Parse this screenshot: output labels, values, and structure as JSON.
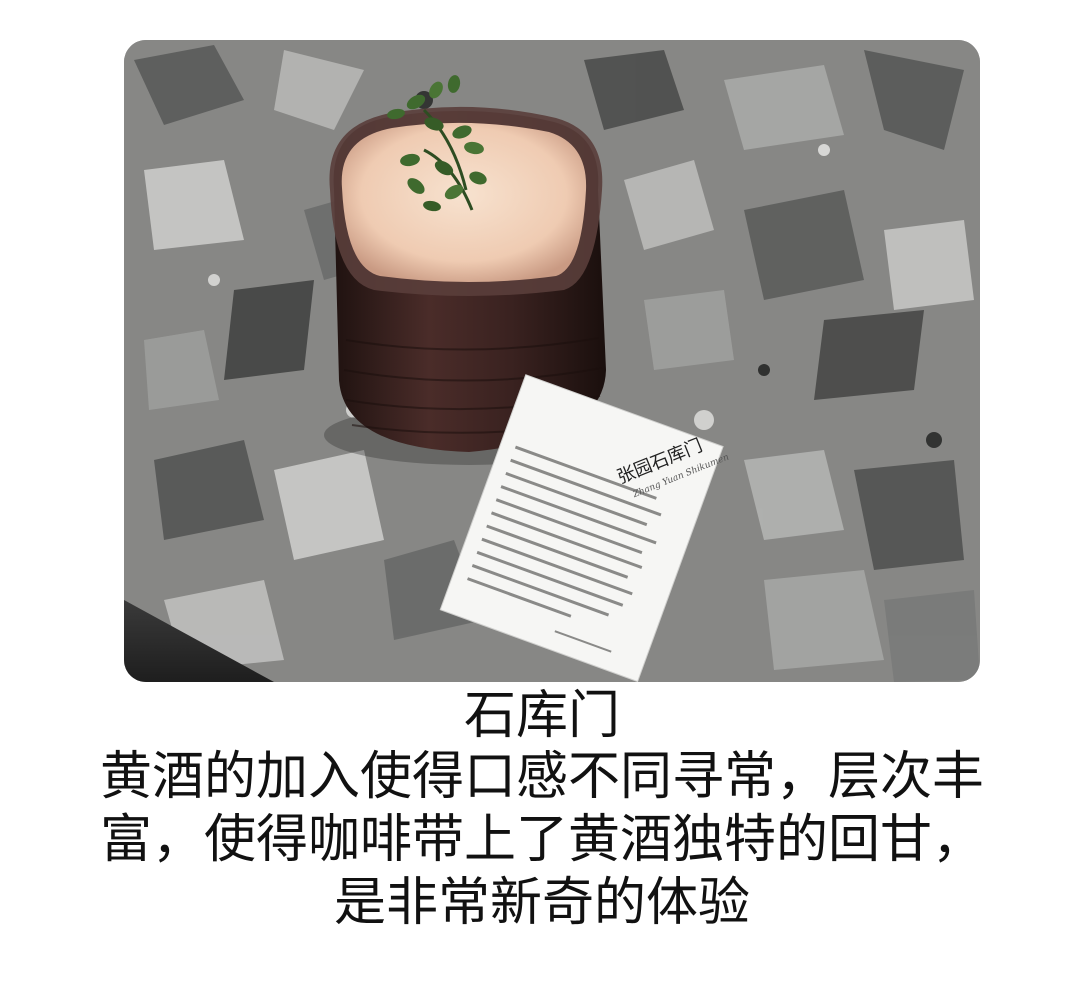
{
  "photo": {
    "description_icon": "coffee-cup-photo",
    "card": {
      "title": "张园石库门",
      "subtitle": "Zhang Yuan Shikumen"
    },
    "colors": {
      "terrazzo_base": "#8a8a88",
      "cup_glaze": "#3a2220",
      "foam": "#f2d7c3",
      "leaf": "#3f6a2e",
      "card": "#f6f6f4"
    }
  },
  "caption": {
    "title": "石库门",
    "lines": [
      "黄酒的加入使得口感不同寻常，层次丰",
      "富，使得咖啡带上了黄酒独特的回甘，",
      "是非常新奇的体验"
    ]
  }
}
